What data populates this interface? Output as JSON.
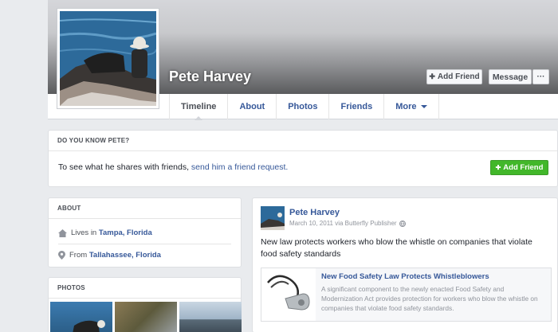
{
  "profile": {
    "name": "Pete Harvey"
  },
  "header_buttons": {
    "add_friend": "Add Friend",
    "message": "Message",
    "more_dots": "···"
  },
  "tabs": [
    {
      "label": "Timeline"
    },
    {
      "label": "About"
    },
    {
      "label": "Photos"
    },
    {
      "label": "Friends"
    },
    {
      "label": "More"
    }
  ],
  "do_you_know": {
    "heading": "DO YOU KNOW PETE?",
    "text_prefix": "To see what he shares with friends, ",
    "link_text": "send him a friend request.",
    "button": "Add Friend"
  },
  "about": {
    "heading": "ABOUT",
    "lives_prefix": "Lives in ",
    "lives_place": "Tampa, Florida",
    "from_prefix": "From ",
    "from_place": "Tallahassee, Florida"
  },
  "photos": {
    "heading": "PHOTOS"
  },
  "post": {
    "author": "Pete Harvey",
    "meta": "March 10, 2011 via Butterfly Publisher",
    "text": "New law protects workers who blow the whistle on companies that violate food safety standards",
    "share_title": "New Food Safety Law Protects Whistleblowers",
    "share_description": "A significant component to the newly enacted Food Safety and Modernization Act provides protection for workers who blow the whistle on companies that violate food safety standards."
  },
  "colors": {
    "link_blue": "#365899",
    "add_friend_green": "#42b72a",
    "background": "#e9ebee"
  }
}
